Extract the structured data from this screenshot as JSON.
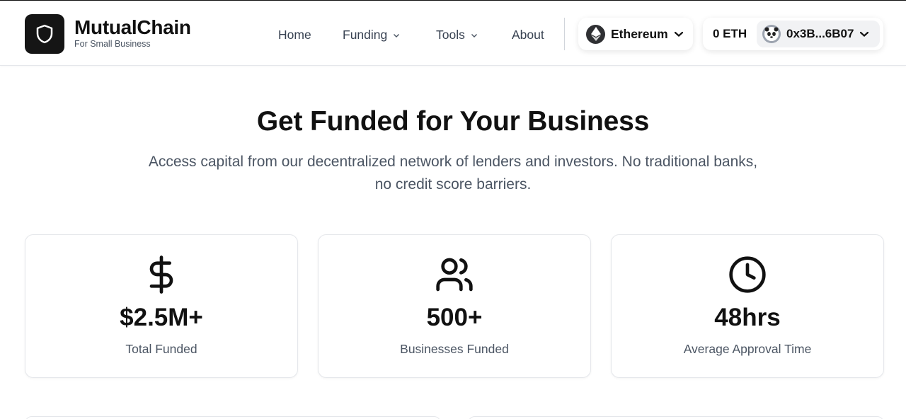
{
  "brand": {
    "name": "MutualChain",
    "tagline": "For Small Business"
  },
  "nav": {
    "items": [
      {
        "label": "Home",
        "has_dropdown": false
      },
      {
        "label": "Funding",
        "has_dropdown": true
      },
      {
        "label": "Tools",
        "has_dropdown": true
      },
      {
        "label": "About",
        "has_dropdown": false
      }
    ]
  },
  "network": {
    "label": "Ethereum",
    "icon": "ethereum-icon"
  },
  "wallet": {
    "balance": "0 ETH",
    "address": "0x3B...6B07",
    "avatar_icon": "panda-avatar-icon"
  },
  "hero": {
    "title": "Get Funded for Your Business",
    "subtitle": "Access capital from our decentralized network of lenders and investors. No traditional banks, no credit score barriers."
  },
  "stats": [
    {
      "icon": "dollar-icon",
      "value": "$2.5M+",
      "label": "Total Funded"
    },
    {
      "icon": "users-icon",
      "value": "500+",
      "label": "Businesses Funded"
    },
    {
      "icon": "clock-icon",
      "value": "48hrs",
      "label": "Average Approval Time"
    }
  ],
  "colors": {
    "logo_bg": "#151515",
    "text_primary": "#111111",
    "text_secondary": "#4b5563",
    "border": "#e5e7eb"
  }
}
